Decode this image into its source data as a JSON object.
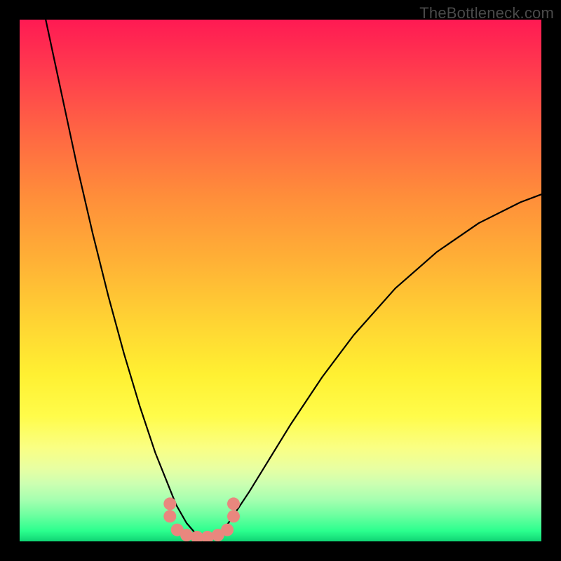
{
  "watermark": "TheBottleneck.com",
  "chart_data": {
    "type": "line",
    "title": "",
    "xlabel": "",
    "ylabel": "",
    "xlim": [
      0,
      1
    ],
    "ylim": [
      0,
      1
    ],
    "series": [
      {
        "name": "curve",
        "x": [
          0.05,
          0.08,
          0.11,
          0.14,
          0.17,
          0.2,
          0.23,
          0.26,
          0.28,
          0.3,
          0.32,
          0.34,
          0.36,
          0.38,
          0.4,
          0.44,
          0.48,
          0.52,
          0.58,
          0.64,
          0.72,
          0.8,
          0.88,
          0.96,
          1.0
        ],
        "y": [
          1.0,
          0.86,
          0.72,
          0.59,
          0.47,
          0.36,
          0.26,
          0.17,
          0.12,
          0.07,
          0.035,
          0.012,
          0.005,
          0.012,
          0.035,
          0.095,
          0.16,
          0.225,
          0.315,
          0.395,
          0.485,
          0.555,
          0.61,
          0.65,
          0.665
        ]
      }
    ],
    "markers": [
      {
        "x": 0.288,
        "y": 0.048
      },
      {
        "x": 0.288,
        "y": 0.072
      },
      {
        "x": 0.302,
        "y": 0.022
      },
      {
        "x": 0.32,
        "y": 0.012
      },
      {
        "x": 0.34,
        "y": 0.008
      },
      {
        "x": 0.36,
        "y": 0.008
      },
      {
        "x": 0.38,
        "y": 0.012
      },
      {
        "x": 0.398,
        "y": 0.022
      },
      {
        "x": 0.41,
        "y": 0.048
      },
      {
        "x": 0.41,
        "y": 0.072
      }
    ]
  }
}
